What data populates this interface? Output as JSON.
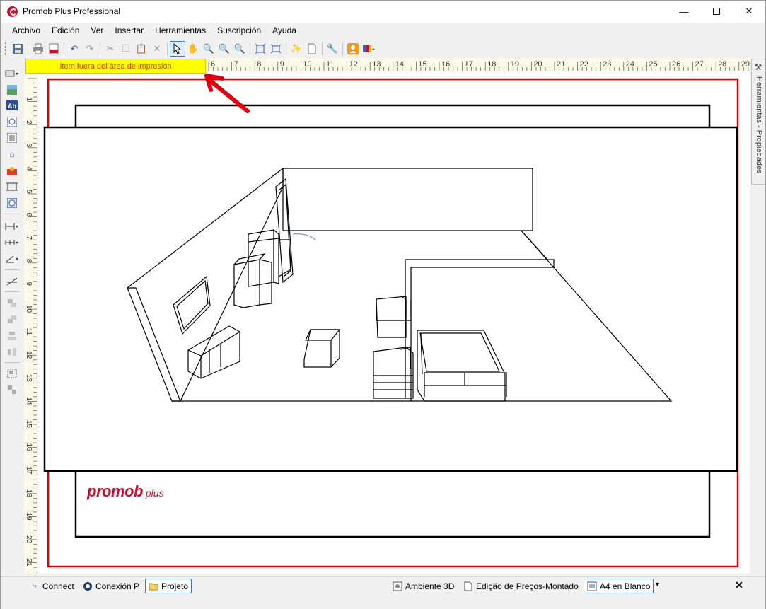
{
  "window": {
    "title": "Promob Plus Professional"
  },
  "menubar": {
    "items": [
      "Archivo",
      "Edición",
      "Ver",
      "Insertar",
      "Herramientas",
      "Suscripción",
      "Ayuda"
    ]
  },
  "warning": {
    "text": "Item fuera del área de impresión"
  },
  "ruler": {
    "h_labels": [
      "6",
      "7",
      "8",
      "9",
      "10",
      "11",
      "12",
      "13",
      "14",
      "15",
      "16",
      "17",
      "18",
      "19",
      "20",
      "21",
      "22",
      "23",
      "24",
      "25",
      "26",
      "27",
      "28",
      "29"
    ],
    "v_labels": [
      "1",
      "2",
      "3",
      "4",
      "5",
      "6",
      "7",
      "8",
      "9",
      "10",
      "11",
      "12",
      "13",
      "14",
      "15",
      "16",
      "17",
      "18",
      "19",
      "20",
      "21"
    ]
  },
  "side_panel": {
    "label": "Herramientas - Propiedades"
  },
  "logo": {
    "main": "promob",
    "sub": "plus"
  },
  "tabs": {
    "left": [
      {
        "label": "Connect",
        "icon": "wifi-icon"
      },
      {
        "label": "Conexión P",
        "icon": "promob-connect-icon"
      },
      {
        "label": "Projeto",
        "icon": "folder-icon"
      }
    ],
    "right": [
      {
        "label": "Ambiente 3D",
        "icon": "ambiente-3d-icon"
      },
      {
        "label": "Edição de Preços-Montado",
        "icon": "document-icon"
      },
      {
        "label": "A4 en Blanco",
        "icon": "page-layout-icon"
      }
    ]
  },
  "colors": {
    "warning_bg": "#ffff00",
    "warning_text": "#d03010",
    "page_border": "#e00000",
    "brand": "#c8102e"
  }
}
